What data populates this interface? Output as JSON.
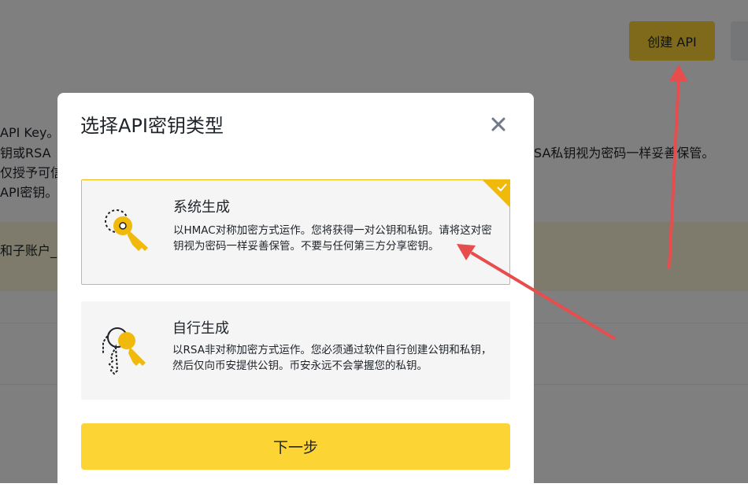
{
  "background": {
    "create_api_button": "创建 API",
    "lines": [
      "API Key。",
      "钥或RSA",
      "仅授予可信",
      "API密钥。"
    ],
    "line_right": "SA私钥视为密码一样妥善保管。",
    "notice_text": "和子账户_"
  },
  "modal": {
    "title": "选择API密钥类型",
    "close_icon": "close-icon",
    "options": [
      {
        "title": "系统生成",
        "description": "以HMAC对称加密方式运作。您将获得一对公钥和私钥。请将这对密钥视为密码一样妥善保管。不要与任何第三方分享密钥。",
        "selected": true,
        "icon": "key-generated-icon"
      },
      {
        "title": "自行生成",
        "description": "以RSA非对称加密方式运作。您必须通过软件自行创建公钥和私钥，然后仅向币安提供公钥。币安永远不会掌握您的私钥。",
        "selected": false,
        "icon": "keys-self-generated-icon"
      }
    ],
    "next_button": "下一步"
  },
  "colors": {
    "accent": "#fcd535",
    "selected_border": "#f0b90b",
    "annotation_arrow": "#e84d4d",
    "overlay": "rgba(0,0,0,0.5)"
  }
}
